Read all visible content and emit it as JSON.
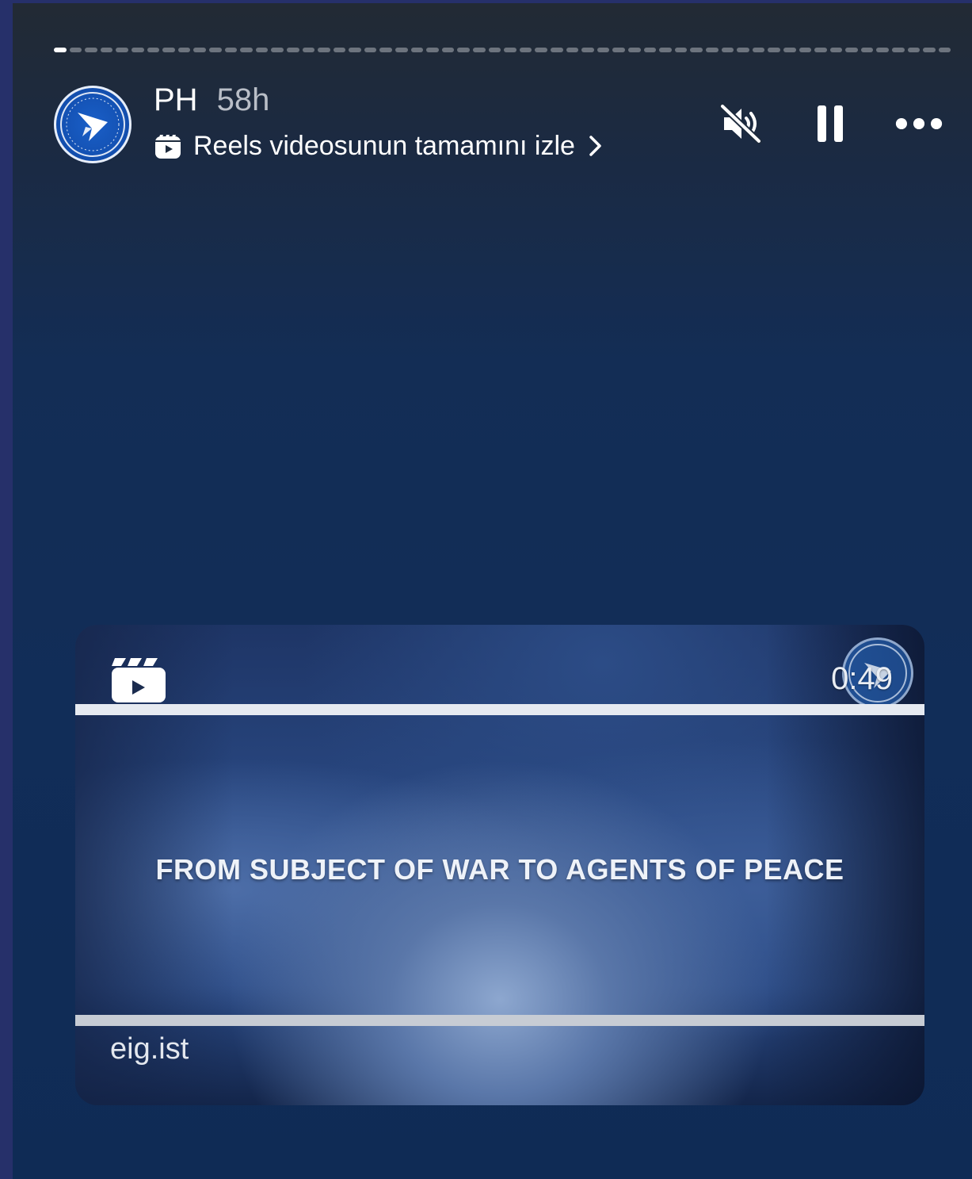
{
  "story": {
    "progress": {
      "segments": 58,
      "completed_segments": 1
    },
    "user": {
      "name": "PH",
      "time": "58h"
    },
    "reels_link": {
      "label": "Reels videosunun tamamını izle"
    },
    "controls": {
      "mute_icon": "speaker-muted-icon",
      "pause_icon": "pause-icon",
      "more_icon": "more-options-icon"
    }
  },
  "reel_card": {
    "duration": "0:49",
    "headline": "FROM SUBJECT OF WAR TO AGENTS OF PEACE",
    "domain": "eig.ist",
    "icon": "reel-clapper-icon"
  },
  "colors": {
    "accent_blue": "#1a5fc8",
    "background_top": "#222a34",
    "background_bottom": "#0f2b55"
  }
}
